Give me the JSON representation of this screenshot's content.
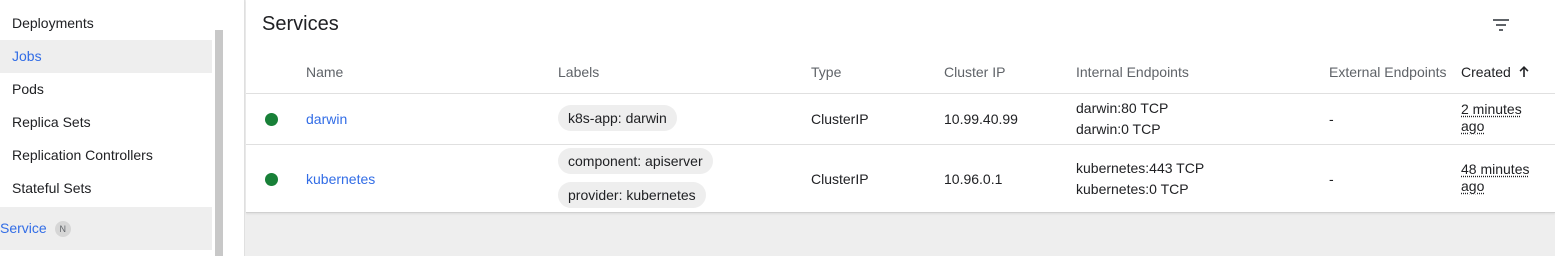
{
  "sidebar": {
    "items": [
      {
        "label": "Deployments"
      },
      {
        "label": "Jobs"
      },
      {
        "label": "Pods"
      },
      {
        "label": "Replica Sets"
      },
      {
        "label": "Replication Controllers"
      },
      {
        "label": "Stateful Sets"
      }
    ],
    "active_item": "Jobs",
    "service": {
      "label": "Service",
      "badge": "N"
    }
  },
  "main": {
    "title": "Services",
    "columns": {
      "name": "Name",
      "labels": "Labels",
      "type": "Type",
      "cluster_ip": "Cluster IP",
      "internal_endpoints": "Internal Endpoints",
      "external_endpoints": "External Endpoints",
      "created": "Created",
      "created_sort_icon": "arrow-up-icon"
    },
    "rows": [
      {
        "status": "green",
        "name": "darwin",
        "labels": [
          "k8s-app: darwin"
        ],
        "type": "ClusterIP",
        "cluster_ip": "10.99.40.99",
        "internal_endpoints": [
          "darwin:80 TCP",
          "darwin:0 TCP"
        ],
        "external_endpoints": "-",
        "created": "2 minutes ago"
      },
      {
        "status": "green",
        "name": "kubernetes",
        "labels": [
          "component: apiserver",
          "provider: kubernetes"
        ],
        "type": "ClusterIP",
        "cluster_ip": "10.96.0.1",
        "internal_endpoints": [
          "kubernetes:443 TCP",
          "kubernetes:0 TCP"
        ],
        "external_endpoints": "-",
        "created": "48 minutes ago"
      }
    ]
  },
  "colors": {
    "accent": "#326de6",
    "status_ok": "#188038"
  },
  "icons": {
    "filter": "filter-icon"
  }
}
